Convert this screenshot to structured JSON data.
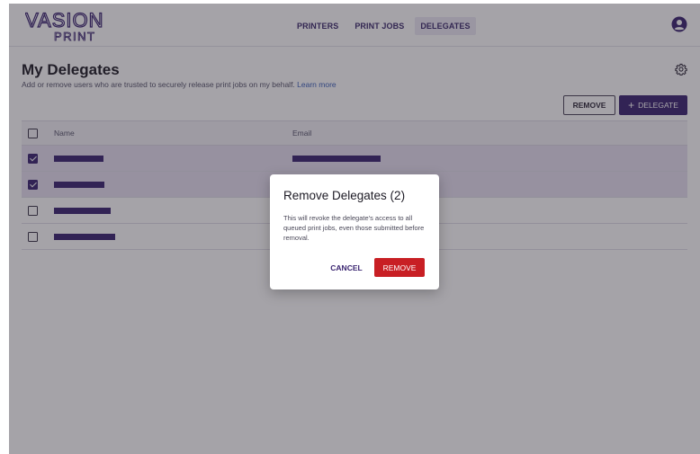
{
  "brand": {
    "logo_top": "VASION",
    "logo_bottom": "PRINT",
    "color": "#3a2470"
  },
  "nav": {
    "items": [
      {
        "label": "PRINTERS",
        "active": false
      },
      {
        "label": "PRINT JOBS",
        "active": false
      },
      {
        "label": "DELEGATES",
        "active": true
      }
    ]
  },
  "header": {
    "avatar_icon": "user-circle-icon"
  },
  "page": {
    "title": "My Delegates",
    "subtitle": "Add or remove users who are trusted to securely release print jobs on my behalf.",
    "learn_more": "Learn more",
    "settings_icon": "gear-icon"
  },
  "toolbar": {
    "remove_label": "REMOVE",
    "add_label": "DELEGATE",
    "add_icon": "+"
  },
  "table": {
    "columns": [
      "Name",
      "Email"
    ],
    "rows": [
      {
        "checked": true
      },
      {
        "checked": true
      },
      {
        "checked": false
      },
      {
        "checked": false
      }
    ]
  },
  "dialog": {
    "title": "Remove Delegates (2)",
    "body": "This will revoke the delegate's access to all queued print jobs, even those submitted before removal.",
    "cancel_label": "CANCEL",
    "confirm_label": "REMOVE"
  },
  "colors": {
    "accent": "#3a2470",
    "danger": "#c81f24",
    "selected_row": "#e7e1f2",
    "link": "#3a5fb8"
  }
}
